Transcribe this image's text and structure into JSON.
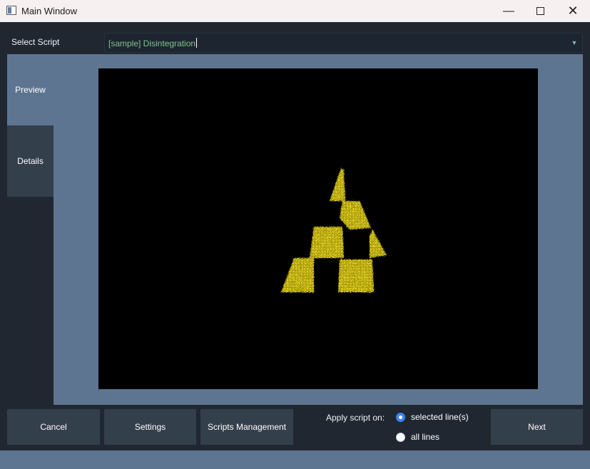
{
  "window": {
    "title": "Main Window"
  },
  "controls": {
    "minimize": "—",
    "close": "✕"
  },
  "script_selector": {
    "label": "Select Script",
    "selected_value": "[sample] Disintegration",
    "caret": "▼"
  },
  "tabs": [
    {
      "label": "Preview"
    },
    {
      "label": "Details"
    }
  ],
  "preview": {
    "background": "#000000",
    "particle_color": "#d6c21c"
  },
  "actions": {
    "cancel_label": "Cancel",
    "settings_label": "Settings",
    "scripts_management_label": "Scripts Management",
    "next_label": "Next"
  },
  "apply_scope": {
    "label": "Apply script on:",
    "options": [
      {
        "label": "selected line(s)",
        "checked": true
      },
      {
        "label": "all lines",
        "checked": false
      }
    ]
  },
  "colors": {
    "window_bg": "#202731",
    "panel_bg": "#5d7590",
    "button_bg": "#343f4c",
    "accent": "#3b82f6",
    "selection_text": "#80c28c"
  }
}
